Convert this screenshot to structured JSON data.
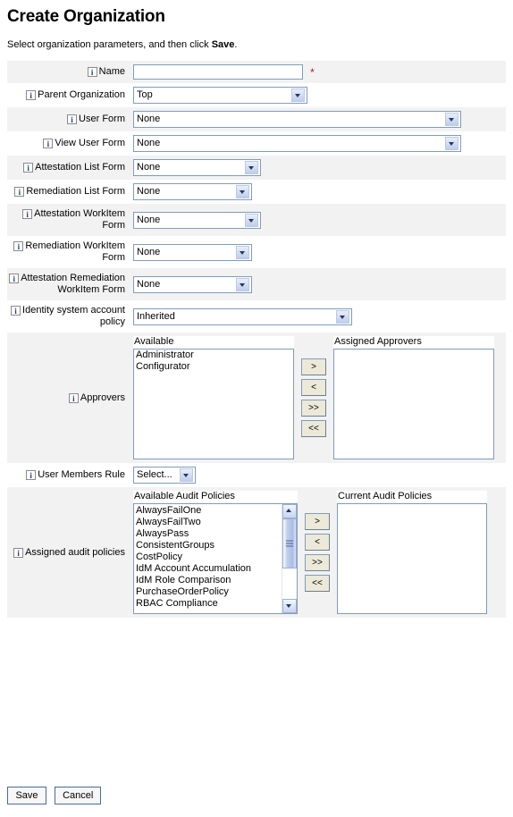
{
  "page": {
    "title": "Create Organization",
    "intro_before": "Select organization parameters, and then click ",
    "intro_bold": "Save",
    "intro_after": ".",
    "required_marker": "*",
    "info_icon_glyph": "i",
    "info_icon_name": "info-icon"
  },
  "fields": {
    "name": {
      "label": "Name",
      "value": "",
      "placeholder": ""
    },
    "parent_organization": {
      "label": "Parent Organization",
      "value": "Top"
    },
    "user_form": {
      "label": "User Form",
      "value": "None"
    },
    "view_user_form": {
      "label": "View User Form",
      "value": "None"
    },
    "attestation_list_form": {
      "label": "Attestation List Form",
      "value": "None"
    },
    "remediation_list_form": {
      "label": "Remediation List Form",
      "value": "None"
    },
    "attestation_workitem_form": {
      "label": "Attestation WorkItem Form",
      "value": "None"
    },
    "remediation_workitem_form": {
      "label": "Remediation WorkItem Form",
      "value": "None"
    },
    "attestation_remediation_workitem_form": {
      "label": "Attestation Remediation WorkItem Form",
      "value": "None"
    },
    "identity_system_account_policy": {
      "label": "Identity system account policy",
      "value": "Inherited"
    },
    "user_members_rule": {
      "label": "User Members Rule",
      "value": "Select..."
    }
  },
  "approvers": {
    "label": "Approvers",
    "available_header": "Available",
    "assigned_header": "Assigned Approvers",
    "available": [
      "Administrator",
      "Configurator"
    ],
    "assigned": [],
    "buttons": {
      "move_right": ">",
      "move_left": "<",
      "move_all_right": ">>",
      "move_all_left": "<<"
    }
  },
  "audit_policies": {
    "label": "Assigned audit policies",
    "available_header": "Available Audit Policies",
    "current_header": "Current Audit Policies",
    "available": [
      "AlwaysFailOne",
      "AlwaysFailTwo",
      "AlwaysPass",
      "ConsistentGroups",
      "CostPolicy",
      "IdM Account Accumulation",
      "IdM Role Comparison",
      "PurchaseOrderPolicy",
      "RBAC Compliance"
    ],
    "current": [],
    "buttons": {
      "move_right": ">",
      "move_left": "<",
      "move_all_right": ">>",
      "move_all_left": "<<"
    }
  },
  "footer": {
    "save_label": "Save",
    "cancel_label": "Cancel"
  },
  "colors": {
    "row_stripe": "#f2f2f2",
    "field_border": "#7f9db9",
    "required_star": "#9c1a1a",
    "info_icon_text": "#1b3f82",
    "button_face": "#ece9d8"
  }
}
